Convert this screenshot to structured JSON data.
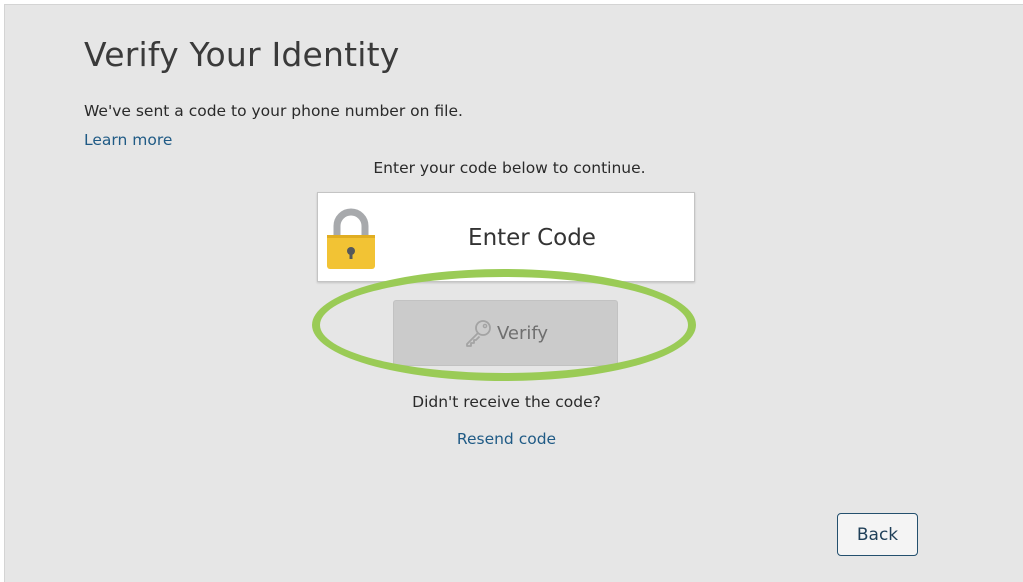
{
  "heading": {
    "title": "Verify Your Identity",
    "sent_message": "We've sent a code to your phone number on file.",
    "learn_more": "Learn more"
  },
  "code_entry": {
    "instruction": "Enter your code below to continue.",
    "placeholder": "Enter Code",
    "value": "",
    "icon": "padlock-icon"
  },
  "verify": {
    "label": "Verify",
    "icon": "key-icon",
    "state": "disabled"
  },
  "resend": {
    "question": "Didn't receive the code?",
    "link": "Resend code"
  },
  "footer": {
    "back_label": "Back"
  },
  "colors": {
    "background": "#e6e6e6",
    "link": "#1f5a85",
    "highlight_ring": "#9acb56",
    "lock_body": "#f2c334",
    "disabled_button": "#cbcbcb"
  }
}
